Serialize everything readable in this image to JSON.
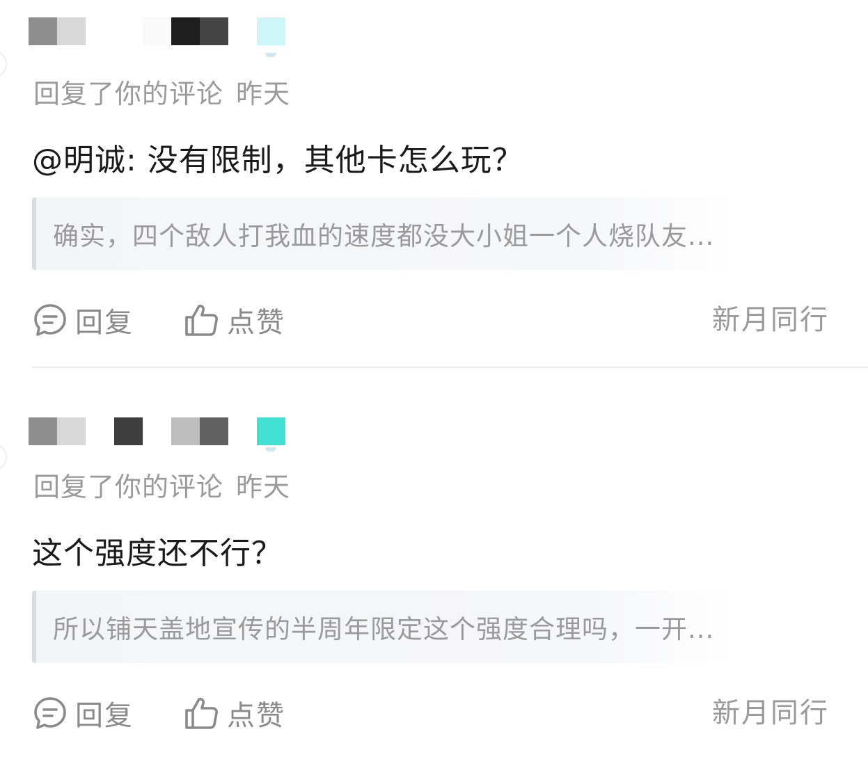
{
  "notifications": [
    {
      "action_text": "回复了你的评论",
      "time": "昨天",
      "reply": "@明诚: 没有限制，其他卡怎么玩？",
      "quoted_comment": "确实，四个敌人打我血的速度都没大小姐一个人烧队友...",
      "reply_button": "回复",
      "like_button": "点赞",
      "source": "新月同行",
      "name_blur_colors": [
        "#8e8e8e",
        "#d8d8d8",
        "#1e1e1e",
        "#444444"
      ],
      "badge_color": "#cdf6f8"
    },
    {
      "action_text": "回复了你的评论",
      "time": "昨天",
      "reply": "这个强度还不行？",
      "quoted_comment": "所以铺天盖地宣传的半周年限定这个强度合理吗，一开...",
      "reply_button": "回复",
      "like_button": "点赞",
      "source": "新月同行",
      "name_blur_colors": [
        "#8e8e8e",
        "#d8d8d8",
        "#3e3e3e",
        "#bdbdbd",
        "#606060"
      ],
      "badge_color": "#43e0d4"
    }
  ],
  "icons": {
    "reply": "chat-bubble-icon",
    "like": "thumbs-up-icon"
  }
}
